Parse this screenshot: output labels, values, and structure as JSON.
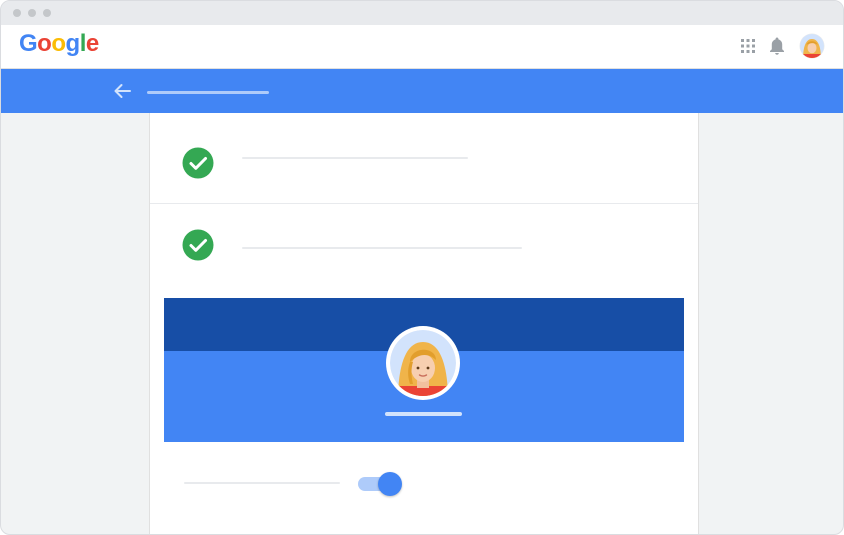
{
  "app": {
    "logo_letters": [
      {
        "char": "G",
        "color": "#4285f4"
      },
      {
        "char": "o",
        "color": "#ea4335"
      },
      {
        "char": "o",
        "color": "#fbbc05"
      },
      {
        "char": "g",
        "color": "#4285f4"
      },
      {
        "char": "l",
        "color": "#34a853"
      },
      {
        "char": "e",
        "color": "#ea4335"
      }
    ]
  },
  "header": {
    "icons": [
      "apps-grid-icon",
      "notifications-bell-icon",
      "account-avatar"
    ]
  },
  "toolbar": {
    "back_icon": "arrow-left-icon",
    "color": "#4285f4"
  },
  "content": {
    "rows": [
      {
        "status": "complete",
        "icon": "check-circle-icon",
        "color": "#34a853"
      },
      {
        "status": "complete",
        "icon": "check-circle-icon",
        "color": "#34a853"
      }
    ],
    "profile_card": {
      "top_color": "#174ea6",
      "bottom_color": "#4285f4"
    },
    "setting": {
      "toggle_on": true,
      "accent": "#4285f4"
    }
  }
}
